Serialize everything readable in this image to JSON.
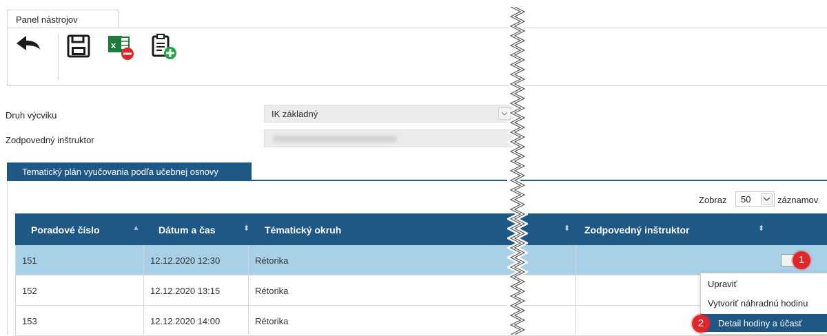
{
  "toolbar": {
    "tab_label": "Panel nástrojov",
    "icons": [
      "back-arrow-icon",
      "save-disk-icon",
      "excel-export-icon",
      "clipboard-add-icon"
    ]
  },
  "form": {
    "training_type_label": "Druh výcviku",
    "training_type_value": "IK základný",
    "instructor_label": "Zodpovedný inštruktor",
    "instructor_value": ""
  },
  "section": {
    "tab_label": "Tematický plán vyučovania podľa učebnej osnovy"
  },
  "pagination": {
    "prefix": "Zobraz",
    "value": "50",
    "suffix": "záznamov"
  },
  "table": {
    "columns": [
      "Poradové číslo",
      "Dátum a čas",
      "Tématický okruh",
      "Zodpovedný inštruktor"
    ],
    "rows": [
      {
        "number": "151",
        "datetime": "12.12.2020 12:30",
        "topic": "Rétorika",
        "instructor": ""
      },
      {
        "number": "152",
        "datetime": "12.12.2020 13:15",
        "topic": "Rétorika",
        "instructor": ""
      },
      {
        "number": "153",
        "datetime": "12.12.2020 14:00",
        "topic": "Rétorika",
        "instructor": ""
      }
    ]
  },
  "context_menu": {
    "items": [
      "Upraviť",
      "Vytvoriť náhradnú hodinu",
      "Detail hodiny a účasť"
    ]
  },
  "badges": [
    "1",
    "2"
  ],
  "colors": {
    "header_blue": "#1f5785",
    "selected_row": "#a8d0e6",
    "badge_red": "#e0262b"
  }
}
